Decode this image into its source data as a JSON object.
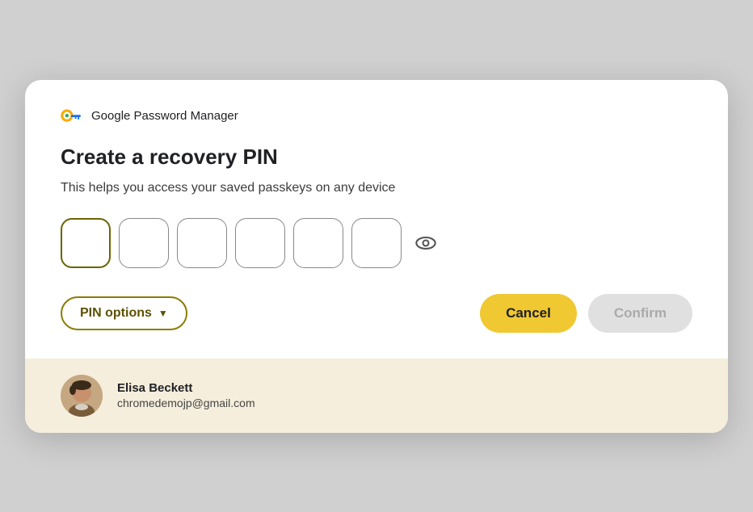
{
  "header": {
    "brand_label": "Google Password Manager"
  },
  "dialog": {
    "title": "Create a recovery PIN",
    "subtitle": "This helps you access your saved passkeys on any device"
  },
  "pin": {
    "boxes": [
      "",
      "",
      "",
      "",
      "",
      ""
    ],
    "eye_label": "toggle visibility"
  },
  "actions": {
    "pin_options_label": "PIN options",
    "cancel_label": "Cancel",
    "confirm_label": "Confirm"
  },
  "footer": {
    "user_name": "Elisa Beckett",
    "user_email": "chromedemojp@gmail.com"
  }
}
